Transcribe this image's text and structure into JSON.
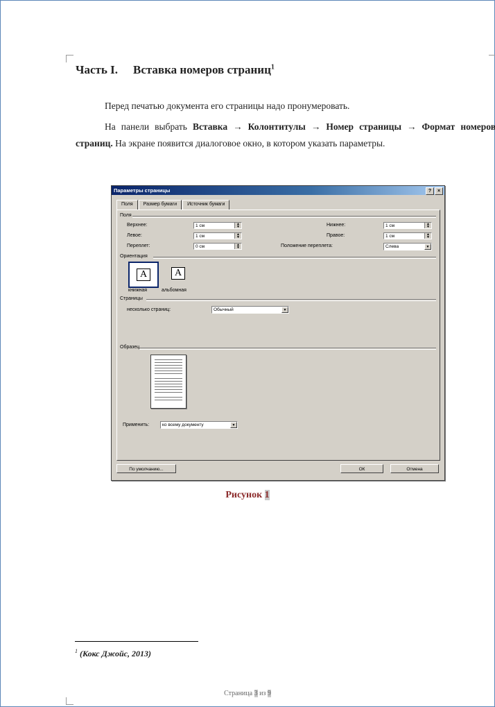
{
  "document": {
    "heading": {
      "part": "Часть I.",
      "title": "Вставка номеров страниц",
      "footnote_mark": "1"
    },
    "paragraph1": "Перед печатью документа его страницы надо пронумеровать.",
    "paragraph2": {
      "prefix": "На панели выбрать ",
      "path": "Вставка → Колонтитулы → Номер страницы → Формат номеров страниц.",
      "suffix": " На экране появится диалоговое окно, в котором указать параметры."
    },
    "caption": {
      "label": "Рисунок ",
      "number": "1"
    },
    "footnote": {
      "mark": "1",
      "text": "(Кокс Джойс, 2013)"
    },
    "page_number": {
      "prefix": "Страница ",
      "current": "3",
      "middle": " из ",
      "total": "9"
    }
  },
  "dialog": {
    "title": "Параметры страницы",
    "title_buttons": [
      "?",
      "×"
    ],
    "tabs": [
      "Поля",
      "Размер бумаги",
      "Источник бумаги"
    ],
    "margins_group": "Поля",
    "fields": {
      "top_label": "Верхнее:",
      "top_value": "1 см",
      "bottom_label": "Нижнее:",
      "bottom_value": "1 см",
      "left_label": "Левое:",
      "left_value": "1 см",
      "right_label": "Правое:",
      "right_value": "1 см",
      "gutter_label": "Переплет:",
      "gutter_value": "0 см",
      "gutter_pos_label": "Положение переплета:",
      "gutter_pos_value": "Слева"
    },
    "orientation_group": "Ориентация",
    "orientation_portrait": "книжная",
    "orientation_landscape": "альбомная",
    "pages_group": "Страницы",
    "multiple_pages_label": "несколько страниц:",
    "multiple_pages_value": "Обычный",
    "sample_group": "Образец",
    "apply_label": "Применить:",
    "apply_value": "ко всему документу",
    "default_button": "По умолчанию...",
    "ok_button": "ОК",
    "cancel_button": "Отмена"
  }
}
